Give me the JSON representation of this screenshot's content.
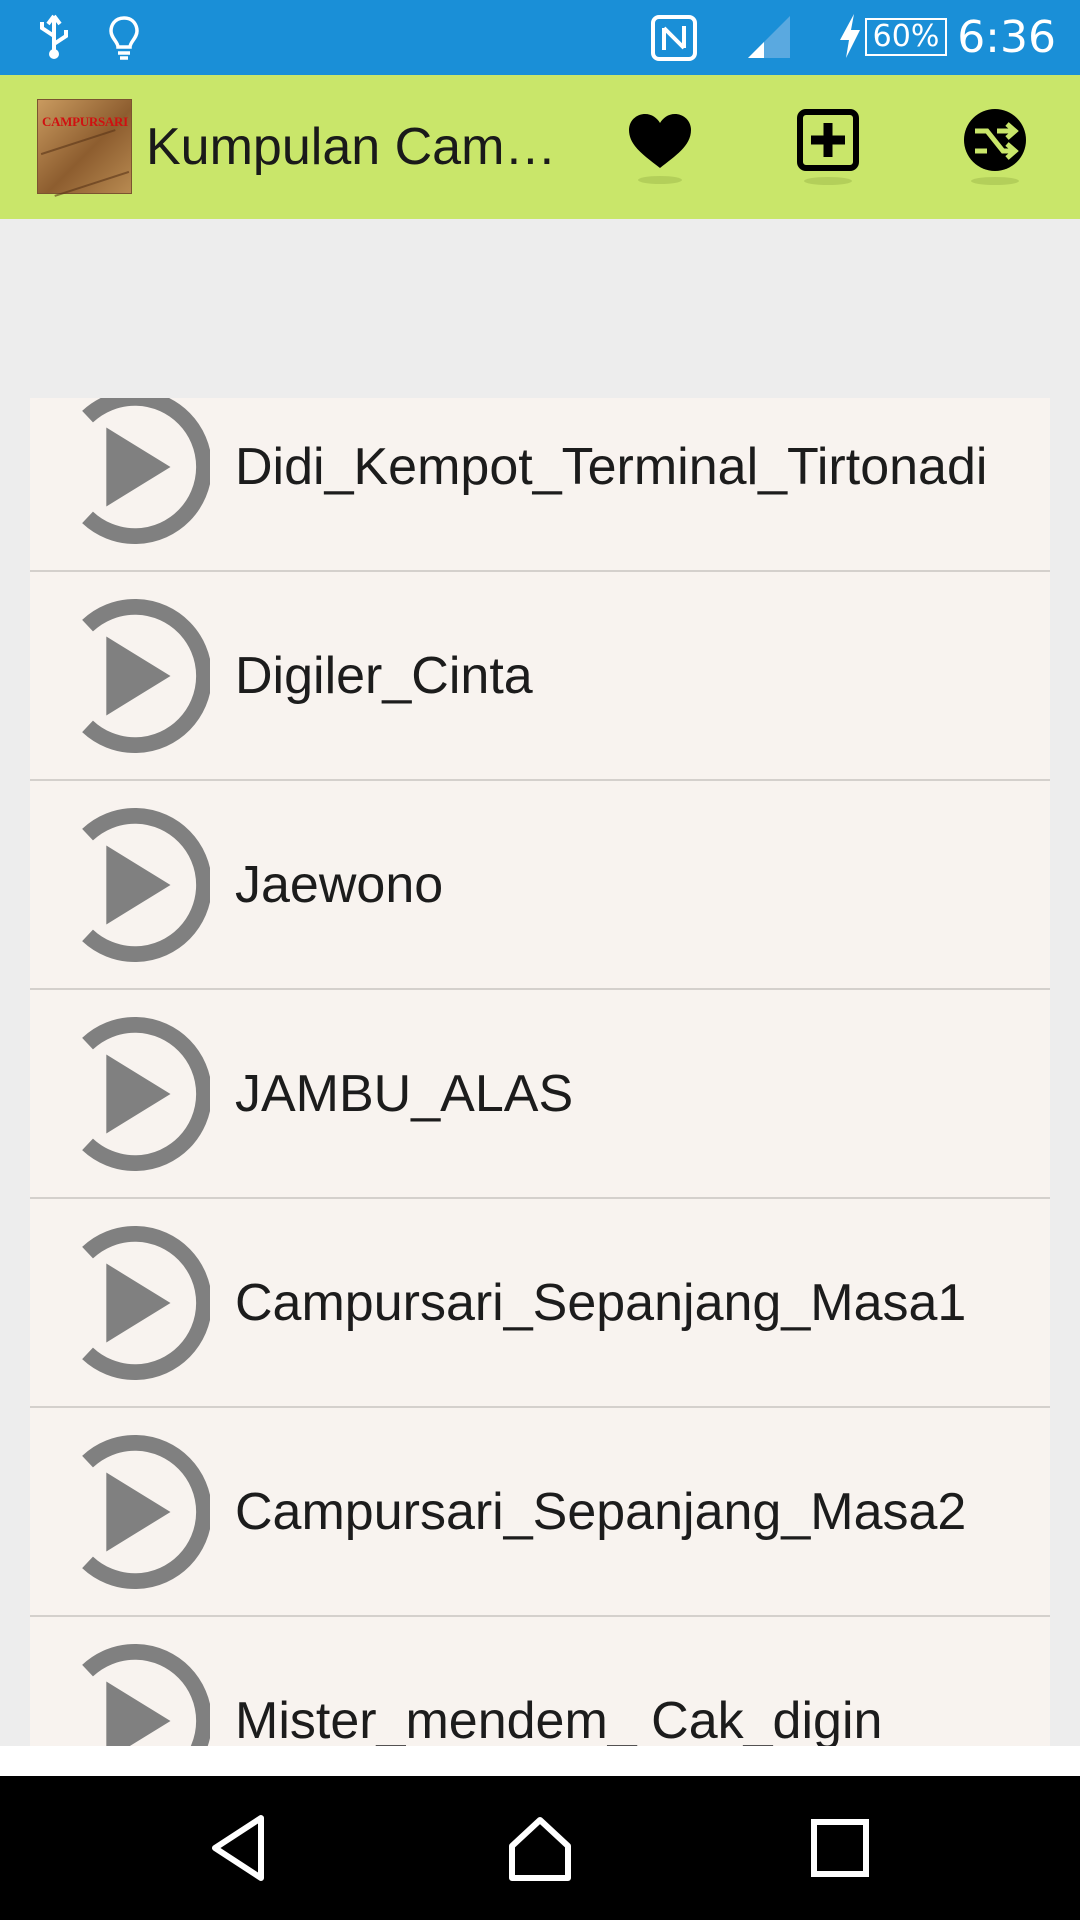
{
  "status_bar": {
    "time": "6:36",
    "battery": "60%",
    "icons": [
      "usb-icon",
      "lightbulb-icon",
      "nfc-icon",
      "signal-icon",
      "charging-icon",
      "battery-icon"
    ]
  },
  "app_bar": {
    "logo_text": "CAMPURSARI",
    "title": "Kumpulan Cam…",
    "actions": [
      "heart-icon",
      "add-box-icon",
      "shuffle-icon"
    ],
    "background": "#c9e66a"
  },
  "songs": {
    "items": [
      {
        "label": "Didi_Kempot_Terminal_Tirtonadi"
      },
      {
        "label": "Digiler_Cinta"
      },
      {
        "label": "Jaewono"
      },
      {
        "label": "JAMBU_ALAS"
      },
      {
        "label": "Campursari_Sepanjang_Masa1"
      },
      {
        "label": "Campursari_Sepanjang_Masa2"
      },
      {
        "label": "Mister_mendem_ Cak_digin"
      }
    ]
  },
  "nav_bar": {
    "buttons": [
      "back-icon",
      "home-icon",
      "recents-icon"
    ]
  },
  "colors": {
    "status_bar": "#1a8fd7",
    "list_bg": "#f8f3ef",
    "play_icon": "#808080"
  }
}
